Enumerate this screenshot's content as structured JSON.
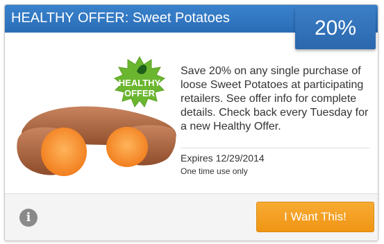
{
  "header": {
    "title": "HEALTHY OFFER: Sweet Potatoes"
  },
  "badge": {
    "discount": "20%"
  },
  "seal": {
    "line1": "HEALTHY",
    "line2": "OFFER",
    "color": "#6bb62f"
  },
  "offer": {
    "description": "Save 20% on any single purchase of loose Sweet Potatoes at participating retailers. See offer info for complete details. Check back every Tuesday for a new Healthy Offer.",
    "expires": "Expires 12/29/2014",
    "usage": "One time use only"
  },
  "footer": {
    "info_icon": "info-icon",
    "cta_label": "I Want This!",
    "cta_color": "#f39c1d"
  },
  "colors": {
    "header": "#2f74bf",
    "accent": "#f39c1d"
  }
}
